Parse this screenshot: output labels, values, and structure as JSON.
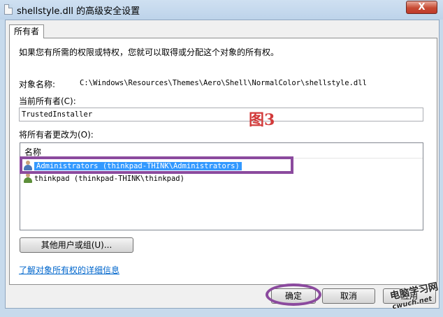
{
  "window": {
    "title": "shellstyle.dll 的高级安全设置",
    "close_label": "X"
  },
  "tab": {
    "label": "所有者"
  },
  "panel": {
    "instruction": "如果您有所需的权限或特权，您就可以取得或分配这个对象的所有权。",
    "object_name_label": "对象名称:",
    "object_name_value": "C:\\Windows\\Resources\\Themes\\Aero\\Shell\\NormalColor\\shellstyle.dll",
    "current_owner_label": "当前所有者(C):",
    "current_owner_value": "TrustedInstaller",
    "change_owner_label": "将所有者更改为(O):",
    "list_header": "名称",
    "owners": [
      {
        "label": "Administrators (thinkpad-THINK\\Administrators)",
        "icon": "group-icon",
        "selected": true
      },
      {
        "label": "thinkpad (thinkpad-THINK\\thinkpad)",
        "icon": "user-icon",
        "selected": false
      }
    ],
    "other_users_button": "其他用户或组(U)...",
    "learn_more_link": "了解对象所有权的详细信息"
  },
  "buttons": {
    "ok": "确定",
    "cancel": "取消",
    "apply": "应用"
  },
  "annotation": {
    "label": "图3",
    "color": "#d23a3a",
    "highlight_color": "#8b4a9e"
  },
  "watermark": {
    "line1": "电脑学习网",
    "line2": "cwuch.net"
  },
  "colors": {
    "selection": "#3399ff",
    "link": "#0066cc",
    "close_button": "#c74b33"
  }
}
